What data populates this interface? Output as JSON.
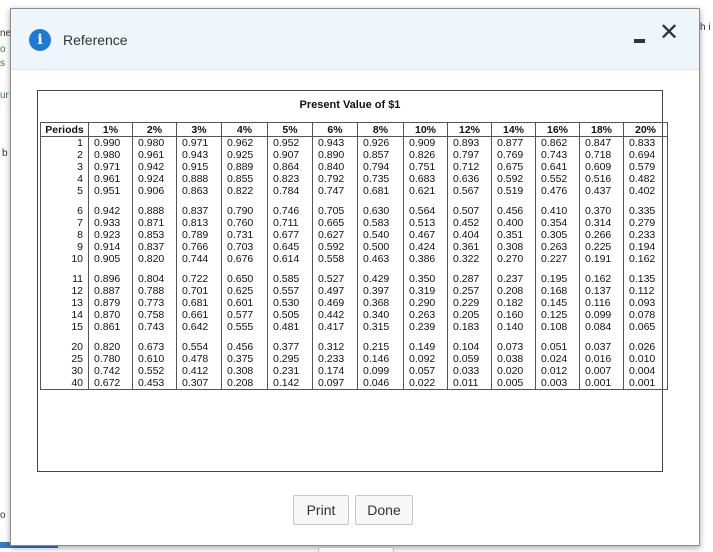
{
  "dialog": {
    "title": "Reference",
    "info_icon": "info-icon",
    "minimize_icon": "minimize-icon",
    "close_icon": "close-icon",
    "close_glyph": "✕"
  },
  "table": {
    "title": "Present Value of $1",
    "columns": [
      "Periods",
      "1%",
      "2%",
      "3%",
      "4%",
      "5%",
      "6%",
      "8%",
      "10%",
      "12%",
      "14%",
      "16%",
      "18%",
      "20%"
    ],
    "groups": [
      [
        [
          "1",
          "0.990",
          "0.980",
          "0.971",
          "0.962",
          "0.952",
          "0.943",
          "0.926",
          "0.909",
          "0.893",
          "0.877",
          "0.862",
          "0.847",
          "0.833"
        ],
        [
          "2",
          "0.980",
          "0.961",
          "0.943",
          "0.925",
          "0.907",
          "0.890",
          "0.857",
          "0.826",
          "0.797",
          "0.769",
          "0.743",
          "0.718",
          "0.694"
        ],
        [
          "3",
          "0.971",
          "0.942",
          "0.915",
          "0.889",
          "0.864",
          "0.840",
          "0.794",
          "0.751",
          "0.712",
          "0.675",
          "0.641",
          "0.609",
          "0.579"
        ],
        [
          "4",
          "0.961",
          "0.924",
          "0.888",
          "0.855",
          "0.823",
          "0.792",
          "0.735",
          "0.683",
          "0.636",
          "0.592",
          "0.552",
          "0.516",
          "0.482"
        ],
        [
          "5",
          "0.951",
          "0.906",
          "0.863",
          "0.822",
          "0.784",
          "0.747",
          "0.681",
          "0.621",
          "0.567",
          "0.519",
          "0.476",
          "0.437",
          "0.402"
        ]
      ],
      [
        [
          "6",
          "0.942",
          "0.888",
          "0.837",
          "0.790",
          "0.746",
          "0.705",
          "0.630",
          "0.564",
          "0.507",
          "0.456",
          "0.410",
          "0.370",
          "0.335"
        ],
        [
          "7",
          "0.933",
          "0.871",
          "0.813",
          "0.760",
          "0.711",
          "0.665",
          "0.583",
          "0.513",
          "0.452",
          "0.400",
          "0.354",
          "0.314",
          "0.279"
        ],
        [
          "8",
          "0.923",
          "0.853",
          "0.789",
          "0.731",
          "0.677",
          "0.627",
          "0.540",
          "0.467",
          "0.404",
          "0.351",
          "0.305",
          "0.266",
          "0.233"
        ],
        [
          "9",
          "0.914",
          "0.837",
          "0.766",
          "0.703",
          "0.645",
          "0.592",
          "0.500",
          "0.424",
          "0.361",
          "0.308",
          "0.263",
          "0.225",
          "0.194"
        ],
        [
          "10",
          "0.905",
          "0.820",
          "0.744",
          "0.676",
          "0.614",
          "0.558",
          "0.463",
          "0.386",
          "0.322",
          "0.270",
          "0.227",
          "0.191",
          "0.162"
        ]
      ],
      [
        [
          "11",
          "0.896",
          "0.804",
          "0.722",
          "0.650",
          "0.585",
          "0.527",
          "0.429",
          "0.350",
          "0.287",
          "0.237",
          "0.195",
          "0.162",
          "0.135"
        ],
        [
          "12",
          "0.887",
          "0.788",
          "0.701",
          "0.625",
          "0.557",
          "0.497",
          "0.397",
          "0.319",
          "0.257",
          "0.208",
          "0.168",
          "0.137",
          "0.112"
        ],
        [
          "13",
          "0.879",
          "0.773",
          "0.681",
          "0.601",
          "0.530",
          "0.469",
          "0.368",
          "0.290",
          "0.229",
          "0.182",
          "0.145",
          "0.116",
          "0.093"
        ],
        [
          "14",
          "0.870",
          "0.758",
          "0.661",
          "0.577",
          "0.505",
          "0.442",
          "0.340",
          "0.263",
          "0.205",
          "0.160",
          "0.125",
          "0.099",
          "0.078"
        ],
        [
          "15",
          "0.861",
          "0.743",
          "0.642",
          "0.555",
          "0.481",
          "0.417",
          "0.315",
          "0.239",
          "0.183",
          "0.140",
          "0.108",
          "0.084",
          "0.065"
        ]
      ],
      [
        [
          "20",
          "0.820",
          "0.673",
          "0.554",
          "0.456",
          "0.377",
          "0.312",
          "0.215",
          "0.149",
          "0.104",
          "0.073",
          "0.051",
          "0.037",
          "0.026"
        ],
        [
          "25",
          "0.780",
          "0.610",
          "0.478",
          "0.375",
          "0.295",
          "0.233",
          "0.146",
          "0.092",
          "0.059",
          "0.038",
          "0.024",
          "0.016",
          "0.010"
        ],
        [
          "30",
          "0.742",
          "0.552",
          "0.412",
          "0.308",
          "0.231",
          "0.174",
          "0.099",
          "0.057",
          "0.033",
          "0.020",
          "0.012",
          "0.007",
          "0.004"
        ],
        [
          "40",
          "0.672",
          "0.453",
          "0.307",
          "0.208",
          "0.142",
          "0.097",
          "0.046",
          "0.022",
          "0.011",
          "0.005",
          "0.003",
          "0.001",
          "0.001"
        ]
      ]
    ]
  },
  "buttons": {
    "print": "Print",
    "done": "Done"
  },
  "background": {
    "fragments": [
      "ne",
      "o",
      "s",
      "ur",
      "h i",
      "b",
      "o"
    ]
  }
}
